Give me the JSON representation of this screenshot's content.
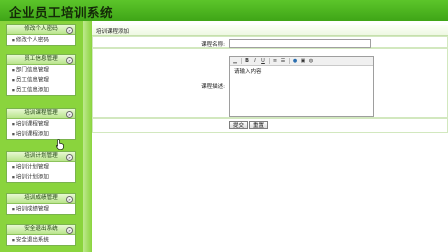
{
  "app": {
    "title": "企业员工培训系统"
  },
  "sidebar": {
    "sections": [
      {
        "title": "修改个人密码",
        "items": [
          "修改个人密码"
        ]
      },
      {
        "title": "员工信息管理",
        "items": [
          "部门信息管理",
          "员工信息管理",
          "员工信息添加"
        ]
      },
      {
        "title": "培训课程管理",
        "items": [
          "培训课程管理",
          "培训课程添加"
        ]
      },
      {
        "title": "培训计划管理",
        "items": [
          "培训计划管理",
          "培训计划添加"
        ]
      },
      {
        "title": "培训成绩管理",
        "items": [
          "培训成绩管理"
        ]
      },
      {
        "title": "安全退出系统",
        "items": [
          "安全退出系统"
        ]
      }
    ],
    "toggle_glyph": "»",
    "bullet_glyph": "■",
    "colors": {
      "background": "#8ad43d",
      "section_border": "#7ab34d"
    }
  },
  "form": {
    "header": "培训课程添加",
    "name_label": "课程名称:",
    "name_value": "",
    "desc_label": "课程描述:",
    "editor": {
      "content": "请输入内容",
      "toolbar": {
        "bold": "B",
        "italic": "I",
        "underline": "U"
      }
    },
    "submit_label": "提交",
    "reset_label": "重置"
  },
  "colors": {
    "header": "#4db522",
    "accent": "#8ad43d"
  }
}
